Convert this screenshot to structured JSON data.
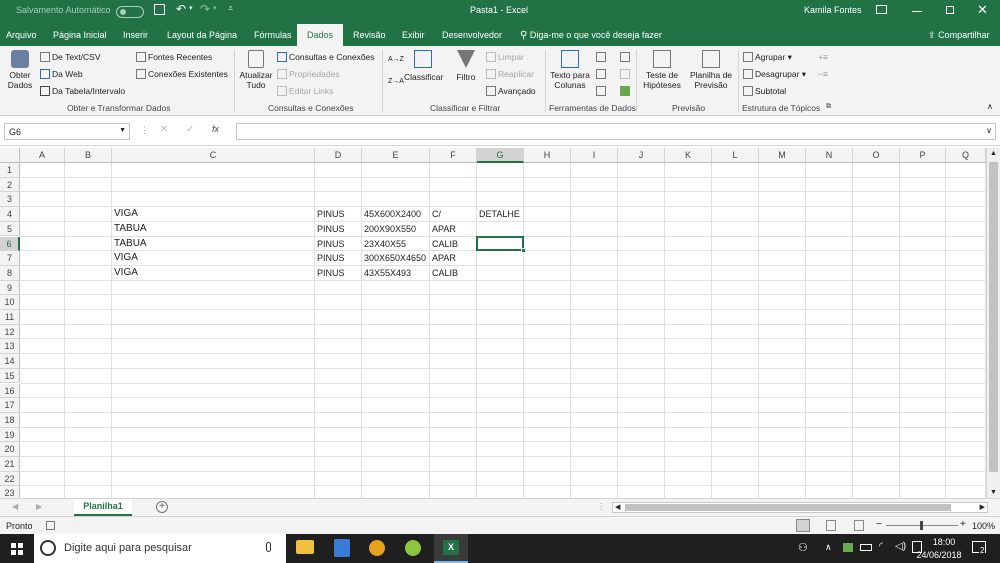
{
  "title_bar": {
    "autosave_label": "Salvamento Automático",
    "autosave_state": "off",
    "doc_title": "Pasta1  -  Excel",
    "user_name": "Kamila Fontes",
    "icons": [
      "save-icon",
      "undo-icon",
      "redo-icon",
      "customize-icon",
      "ribbon-display-icon",
      "minimize-icon",
      "restore-icon",
      "close-icon"
    ]
  },
  "tabs": {
    "arquivo": "Arquivo",
    "pagina_inicial": "Página Inicial",
    "inserir": "Inserir",
    "layout": "Layout da Página",
    "formulas": "Fórmulas",
    "dados": "Dados",
    "revisao": "Revisão",
    "exibir": "Exibir",
    "desenvolvedor": "Desenvolvedor",
    "tell_me": "Diga-me o que você deseja fazer",
    "share": "Compartilhar"
  },
  "ribbon": {
    "obter_dados_1": "Obter",
    "obter_dados_2": "Dados",
    "de_text_csv": "De Text/CSV",
    "da_web": "Da Web",
    "da_tabela": "Da Tabela/Intervalo",
    "fontes_recentes": "Fontes Recentes",
    "conexoes_existentes": "Conexões Existentes",
    "group_obter": "Obter e Transformar Dados",
    "atualizar_1": "Atualizar",
    "atualizar_2": "Tudo",
    "consultas_conexoes": "Consultas e Conexões",
    "propriedades": "Propriedades",
    "editar_links": "Editar Links",
    "group_consultas": "Consultas e Conexões",
    "sort_az": "A→Z",
    "sort_za": "Z→A",
    "classificar": "Classificar",
    "filtro": "Filtro",
    "limpar": "Limpar",
    "reaplicar": "Reaplicar",
    "avancado": "Avançado",
    "group_classificar": "Classificar e Filtrar",
    "texto_colunas_1": "Texto para",
    "texto_colunas_2": "Colunas",
    "group_ferramentas": "Ferramentas de Dados",
    "teste_hipoteses_1": "Teste de",
    "teste_hipoteses_2": "Hipóteses",
    "planilha_previsao_1": "Planilha de",
    "planilha_previsao_2": "Previsão",
    "group_previsao": "Previsão",
    "agrupar": "Agrupar",
    "desagrupar": "Desagrupar",
    "subtotal": "Subtotal",
    "group_estrutura": "Estrutura de Tópicos"
  },
  "formula_bar": {
    "name_box": "G6",
    "fx_label": "fx",
    "formula": ""
  },
  "grid": {
    "columns": [
      "A",
      "B",
      "C",
      "D",
      "E",
      "F",
      "G",
      "H",
      "I",
      "J",
      "K",
      "L",
      "M",
      "N",
      "O",
      "P",
      "Q"
    ],
    "rows": [
      "1",
      "2",
      "3",
      "4",
      "5",
      "6",
      "7",
      "8",
      "9",
      "10",
      "11",
      "12",
      "13",
      "14",
      "15",
      "16",
      "17",
      "18",
      "19",
      "20",
      "21",
      "22",
      "23"
    ],
    "selected_cell": "G6",
    "cells": {
      "C4": "VIGA",
      "D4": "PINUS",
      "E4": "45X600X2400",
      "F4": "C/",
      "G4": "DETALHE",
      "C5": "TABUA",
      "D5": "PINUS",
      "E5": "200X90X550",
      "F5": "APAR",
      "C6": "TABUA",
      "D6": "PINUS",
      "E6": "23X40X55",
      "F6": "CALIB",
      "C7": "VIGA",
      "D7": "PINUS",
      "E7": "300X650X4650",
      "F7": "APAR",
      "C8": "VIGA",
      "D8": "PINUS",
      "E8": "43X55X493",
      "F8": "CALIB"
    }
  },
  "sheet_tabs": {
    "active": "Planilha1"
  },
  "status_bar": {
    "status": "Pronto",
    "zoom": "100%"
  },
  "taskbar": {
    "search_placeholder": "Digite aqui para pesquisar",
    "time": "18:00",
    "date": "24/06/2018",
    "notification_count": "2"
  },
  "colors": {
    "excel_green": "#217346",
    "taskbar_bg": "#1f1f1f"
  }
}
